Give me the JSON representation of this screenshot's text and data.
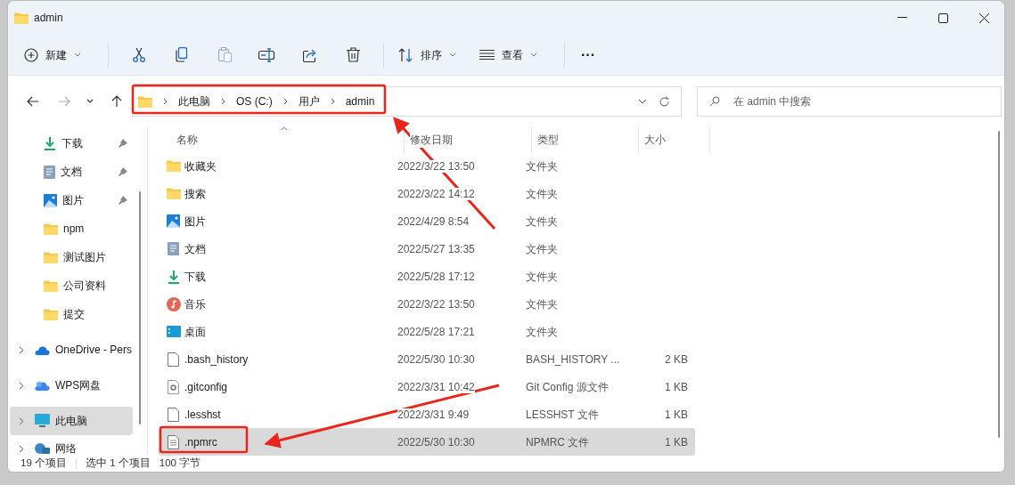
{
  "window": {
    "title": "admin"
  },
  "toolbar": [
    {
      "kind": "menu",
      "label": "新建",
      "disabled": false
    },
    {
      "kind": "divider"
    },
    {
      "kind": "icon",
      "disabled": false
    },
    {
      "kind": "icon",
      "disabled": false
    },
    {
      "kind": "icon",
      "disabled": true
    },
    {
      "kind": "icon",
      "disabled": false
    },
    {
      "kind": "icon",
      "disabled": false
    },
    {
      "kind": "icon",
      "disabled": false
    },
    {
      "kind": "divider"
    },
    {
      "kind": "menu",
      "label": "排序",
      "disabled": false
    },
    {
      "kind": "menu",
      "label": "查看",
      "disabled": false
    },
    {
      "kind": "divider"
    },
    {
      "kind": "more",
      "label": "···",
      "disabled": false
    }
  ],
  "navigation": [
    {
      "disabled": false
    },
    {
      "disabled": true
    },
    {
      "disabled": false
    },
    {
      "disabled": false
    }
  ],
  "breadcrumb": [
    "此电脑",
    "OS (C:)",
    "用户",
    "admin"
  ],
  "search": {
    "placeholder": "在 admin 中搜索"
  },
  "sidebar": {
    "items": [
      {
        "label": "下载",
        "kind": "download",
        "pinned": true,
        "expandable": false,
        "selected": false
      },
      {
        "label": "文档",
        "kind": "document",
        "pinned": true,
        "expandable": false,
        "selected": false
      },
      {
        "label": "图片",
        "kind": "picture",
        "pinned": true,
        "expandable": false,
        "selected": false
      },
      {
        "label": "npm",
        "kind": "folder",
        "pinned": false,
        "expandable": false,
        "selected": false
      },
      {
        "label": "测试图片",
        "kind": "folder",
        "pinned": false,
        "expandable": false,
        "selected": false
      },
      {
        "label": "公司资料",
        "kind": "folder",
        "pinned": false,
        "expandable": false,
        "selected": false
      },
      {
        "label": "提交",
        "kind": "folder",
        "pinned": false,
        "expandable": false,
        "selected": false
      },
      {
        "label": "OneDrive - Pers",
        "kind": "cloud",
        "pinned": false,
        "expandable": true,
        "selected": false
      },
      {
        "label": "WPS网盘",
        "kind": "cloud2",
        "pinned": false,
        "expandable": true,
        "selected": false
      },
      {
        "label": "此电脑",
        "kind": "pc",
        "pinned": false,
        "expandable": true,
        "selected": true
      },
      {
        "label": "网络",
        "kind": "network",
        "pinned": false,
        "expandable": true,
        "selected": false
      }
    ]
  },
  "table": {
    "columns": [
      "名称",
      "修改日期",
      "类型",
      "大小"
    ],
    "rows": [
      {
        "name": "收藏夹",
        "date": "2022/3/22 13:50",
        "type": "文件夹",
        "kind": "folder",
        "selected": false
      },
      {
        "name": "搜索",
        "date": "2022/3/22 14:12",
        "type": "文件夹",
        "kind": "folder",
        "selected": false
      },
      {
        "name": "图片",
        "date": "2022/4/29 8:54",
        "type": "文件夹",
        "kind": "picture",
        "selected": false
      },
      {
        "name": "文档",
        "date": "2022/5/27 13:35",
        "type": "文件夹",
        "kind": "document",
        "selected": false
      },
      {
        "name": "下载",
        "date": "2022/5/28 17:12",
        "type": "文件夹",
        "kind": "download",
        "selected": false
      },
      {
        "name": "音乐",
        "date": "2022/3/22 13:50",
        "type": "文件夹",
        "kind": "music",
        "selected": false
      },
      {
        "name": "桌面",
        "date": "2022/5/28 17:21",
        "type": "文件夹",
        "kind": "desktop",
        "selected": false
      },
      {
        "name": ".bash_history",
        "date": "2022/5/30 10:30",
        "type": "BASH_HISTORY ...",
        "size": "2 KB",
        "kind": "file",
        "selected": false
      },
      {
        "name": ".gitconfig",
        "date": "2022/3/31 10:42",
        "type": "Git Config 源文件",
        "size": "1 KB",
        "kind": "config",
        "selected": false
      },
      {
        "name": ".lesshst",
        "date": "2022/3/31 9:49",
        "type": "LESSHST 文件",
        "size": "1 KB",
        "kind": "file",
        "selected": false
      },
      {
        "name": ".npmrc",
        "date": "2022/5/30 10:30",
        "type": "NPMRC 文件",
        "size": "1 KB",
        "kind": "text",
        "selected": true
      }
    ]
  },
  "status_bar": [
    "19 个项目",
    "选中 1 个项目",
    "100 字节"
  ]
}
